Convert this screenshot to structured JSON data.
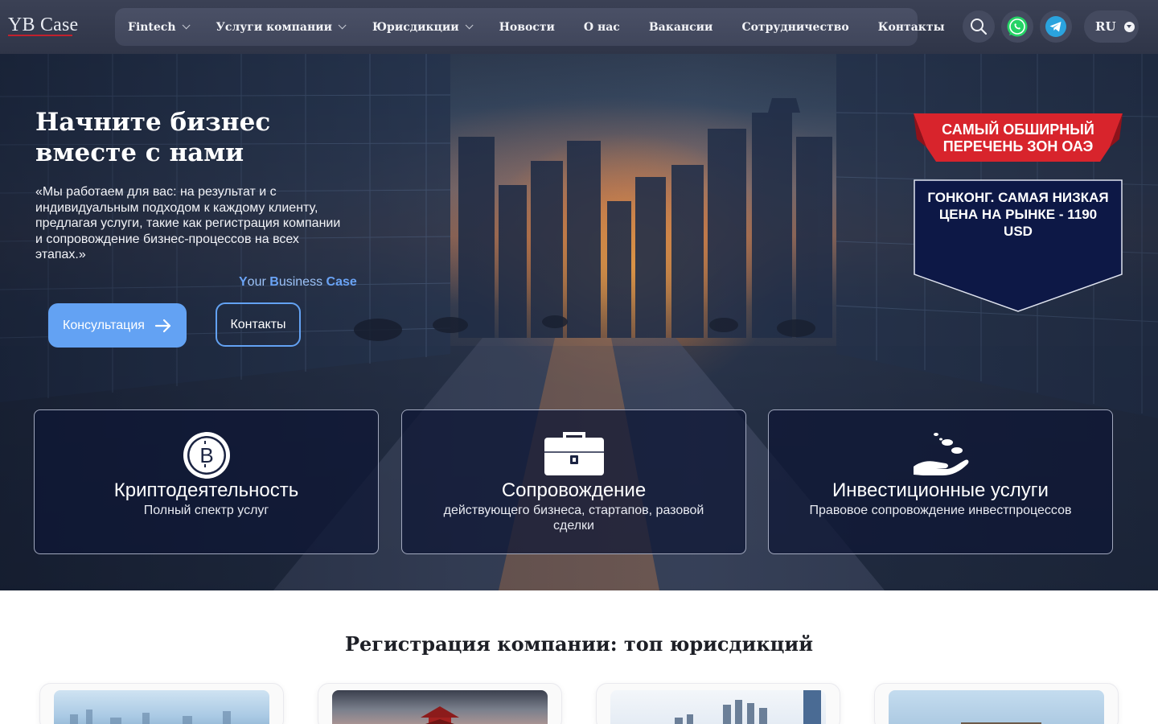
{
  "header": {
    "logo": "YB Case",
    "nav": [
      {
        "label": "Fintech",
        "dropdown": true
      },
      {
        "label": "Услуги компании",
        "dropdown": true
      },
      {
        "label": "Юрисдикции",
        "dropdown": true
      },
      {
        "label": "Новости",
        "dropdown": false
      },
      {
        "label": "О нас",
        "dropdown": false
      },
      {
        "label": "Вакансии",
        "dropdown": false
      },
      {
        "label": "Сотрудничество",
        "dropdown": false
      },
      {
        "label": "Контакты",
        "dropdown": false
      }
    ],
    "icons": [
      "search-icon",
      "whatsapp-icon",
      "telegram-icon"
    ],
    "language": "RU"
  },
  "hero": {
    "title_line1": "Начните бизнес",
    "title_line2": "вместе с нами",
    "text": "«Мы работаем для вас: на результат и с индивидуальным подходом к каждому клиенту, предлагая услуги, такие как регистрация компании и сопровождение бизнес-процессов на всех этапах.»",
    "tagline": {
      "y": "Y",
      "our": "our ",
      "b": "B",
      "usiness": "usiness ",
      "case": "Case"
    },
    "primary_button": "Консультация",
    "secondary_button": "Контакты"
  },
  "promos": {
    "ribbon": "САМЫЙ ОБШИРНЫЙ ПЕРЕЧЕНЬ ЗОН ОАЭ",
    "shield": "ГОНКОНГ. САМАЯ НИЗКАЯ ЦЕНА НА РЫНКЕ - 1190 USD"
  },
  "cards": [
    {
      "icon": "bitcoin-icon",
      "title": "Криптодеятельность",
      "subtitle": "Полный спектр услуг"
    },
    {
      "icon": "briefcase-icon",
      "title": "Сопровождение",
      "subtitle": "действующего бизнеса, стартапов, разовой сделки"
    },
    {
      "icon": "hand-coins-icon",
      "title": "Инвестиционные услуги",
      "subtitle": "Правовое сопровождение инвестпроцессов"
    }
  ],
  "section": {
    "title": "Регистрация компании: топ юрисдикций"
  },
  "colors": {
    "accent": "#63a2f3",
    "header": "#3b4155",
    "ribbon": "#d8242c",
    "shield": "#0d1846",
    "logo_underline": "#c2202d"
  }
}
